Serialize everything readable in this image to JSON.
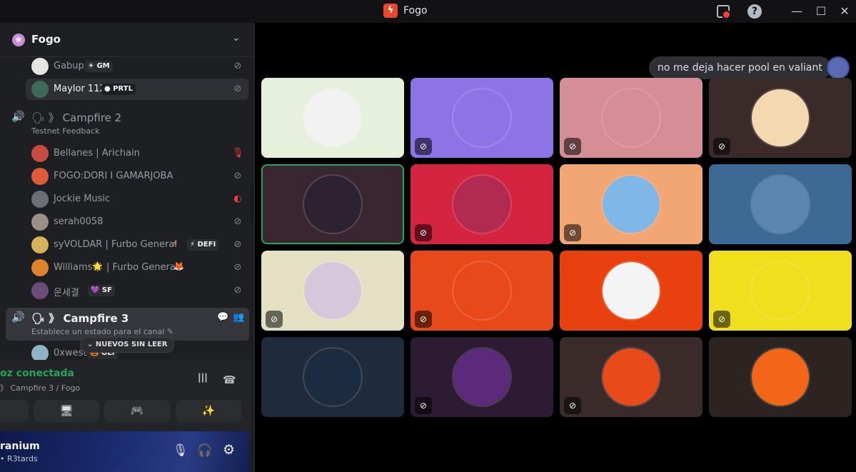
{
  "app": {
    "title": "Fogo",
    "logo": "ϟ",
    "help": "?",
    "minimize": "—",
    "maximize": "☐",
    "close": "✕"
  },
  "server": {
    "name": "Fogo",
    "chevron": "⌄",
    "icon": "❀"
  },
  "top_users": [
    {
      "name": "Gabup",
      "tag": "☀ GM",
      "avatar_color": "#e8e6e2",
      "muted": true
    },
    {
      "name": "Maylor 112",
      "tag": "● PRTL",
      "avatar_color": "#3c6b5a",
      "muted": true,
      "selected": true
    }
  ],
  "campfire2": {
    "speaker": "🔊",
    "name": "🗣 》 Campfire 2",
    "status": "Testnet Feedback"
  },
  "campfire2_users": [
    {
      "name": "Bellanes | Arichain",
      "avatar_color": "#c94a3f",
      "mute_icon": "🎙",
      "mute_red": true
    },
    {
      "name": "FOGO:DORI I GAMARJOBA",
      "avatar_color": "#e05a3a",
      "mute_icon": "⊘",
      "mute_red": false
    },
    {
      "name": "Jockie Music",
      "avatar_color": "#6b6f78",
      "mute_icon": "◐",
      "mute_red": true
    },
    {
      "name": "serah0058",
      "avatar_color": "#9b8f86",
      "mute_icon": "⊘",
      "mute_red": false
    },
    {
      "name": "syVOLDAR | Furbo General",
      "avatar_color": "#d6b25a",
      "mute_icon": "⊘",
      "mute_red": false,
      "emoji": "⚡",
      "tag": "⚡ DEFI"
    },
    {
      "name": "Williams",
      "avatar_color": "#e0822a",
      "mute_icon": "⊘",
      "mute_red": false,
      "emoji": "🌟",
      "name2": "| Furbo General",
      "emoji2": "🦊"
    },
    {
      "name": "운세결",
      "avatar_color": "#6a4b7a",
      "mute_icon": "⊘",
      "mute_red": false,
      "tag": "💜 SF"
    }
  ],
  "campfire3": {
    "speaker": "🔊",
    "name": "🗣 》 Campfire 3",
    "status": "Establece un estado para el canal ✎",
    "chat_icon": "💬",
    "invite_icon": "👥"
  },
  "campfire3_users": [
    {
      "name": "0xwest",
      "tag": "🎃 OLI",
      "avatar_color": "#8fb3c7"
    }
  ],
  "unread_pill": "⌄  NUEVOS SIN LEER",
  "voice": {
    "status": "oz conectada",
    "location": "》 Campfire 3 / Fogo",
    "soundboard_icon": "┃┃┃",
    "disconnect_icon": "☎",
    "actions": [
      "●",
      "🖥",
      "🎮",
      "✨"
    ]
  },
  "user_panel": {
    "name": "ranium",
    "sub": "• R3tards",
    "mic_icon": "🎙",
    "headset_icon": "🎧",
    "settings_icon": "⚙"
  },
  "chat": {
    "message": "no me deja hacer pool en valiant"
  },
  "tiles": [
    {
      "bg": "#e7f0dc",
      "avatar": "#f2f2f2",
      "muted": false,
      "speaking": false
    },
    {
      "bg": "#8d74e6",
      "avatar": "#8d74e6",
      "muted": true,
      "speaking": false
    },
    {
      "bg": "#d68e96",
      "avatar": "#d68e96",
      "muted": true,
      "speaking": false
    },
    {
      "bg": "#3b2a2a",
      "avatar": "#f4d9b0",
      "muted": true,
      "speaking": false
    },
    {
      "bg": "#3a2630",
      "avatar": "#2c2232",
      "muted": false,
      "speaking": true
    },
    {
      "bg": "#d42440",
      "avatar": "#b02a52",
      "muted": true,
      "speaking": false
    },
    {
      "bg": "#f2a673",
      "avatar": "#7fb7e6",
      "muted": true,
      "speaking": false
    },
    {
      "bg": "#3d6a94",
      "avatar": "#5a86b0",
      "muted": false,
      "speaking": false
    },
    {
      "bg": "#e3e0c4",
      "avatar": "#d6c7dc",
      "muted": true,
      "speaking": false
    },
    {
      "bg": "#e8491a",
      "avatar": "#e8491a",
      "muted": true,
      "speaking": false
    },
    {
      "bg": "#e8410f",
      "avatar": "#f4f4f4",
      "muted": false,
      "speaking": false
    },
    {
      "bg": "#f0df1c",
      "avatar": "#f0df1c",
      "muted": true,
      "speaking": false
    },
    {
      "bg": "#1f2a3c",
      "avatar": "#1b2b40",
      "muted": false,
      "speaking": false
    },
    {
      "bg": "#2d1a33",
      "avatar": "#5b2a7a",
      "muted": true,
      "speaking": false
    },
    {
      "bg": "#3a2a2a",
      "avatar": "#e84a1a",
      "muted": true,
      "speaking": false
    },
    {
      "bg": "#2b2420",
      "avatar": "#f2661a",
      "muted": false,
      "speaking": false
    }
  ],
  "mute_glyph": "⊘"
}
